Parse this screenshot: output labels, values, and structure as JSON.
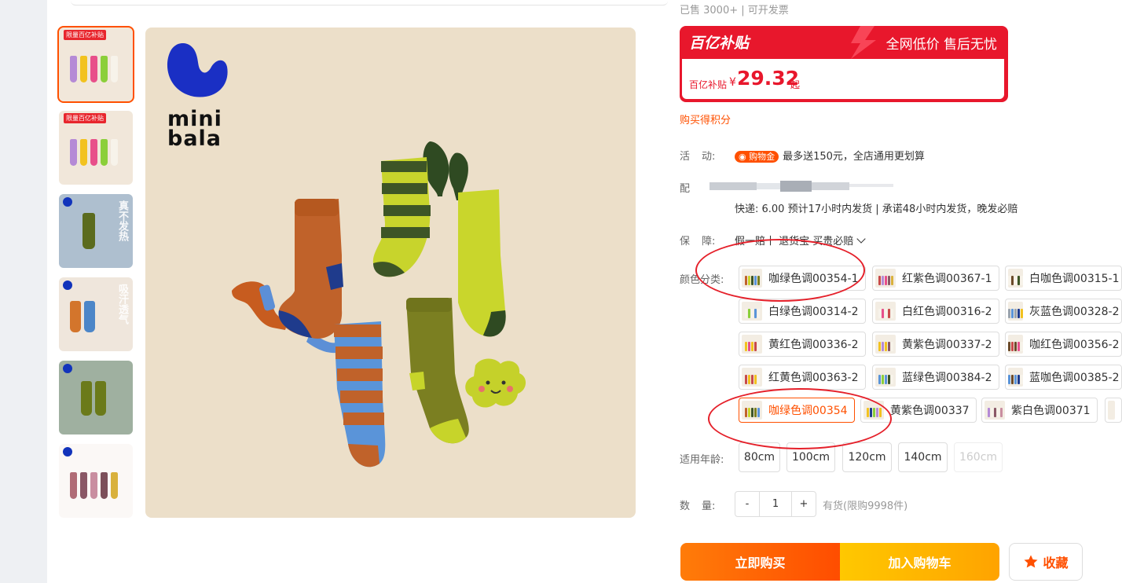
{
  "top": {
    "sold_text": "已售 3000+ | 可开发票"
  },
  "brand": {
    "logo_line1": "mini",
    "logo_line2": "bala"
  },
  "thumbnails": [
    {
      "badge": "限量百亿补贴",
      "overlay": ""
    },
    {
      "badge": "限量百亿补贴",
      "overlay": ""
    },
    {
      "badge": "",
      "overlay": "真不发热"
    },
    {
      "badge": "",
      "overlay": "吸汗透气"
    },
    {
      "badge": "",
      "overlay": ""
    },
    {
      "badge": "",
      "overlay": ""
    }
  ],
  "promo": {
    "badge": "百亿补贴",
    "slogan": "全网低价 售后无忧",
    "price_label": "百亿补贴",
    "currency": "¥",
    "price": "29.32",
    "price_suffix": "起"
  },
  "points_text": "购买得积分",
  "activity": {
    "label_a": "活",
    "label_b": "动:",
    "coin": "购物金",
    "text": "最多送150元，全店通用更划算"
  },
  "delivery": {
    "label": "配",
    "shipping": "快递: 6.00  预计17小时内发货 | 承诺48小时内发货，晚发必赔"
  },
  "guarantee": {
    "label_a": "保",
    "label_b": "障:",
    "text": "假一赔十 退货宝 买贵必赔"
  },
  "color": {
    "label": "颜色分类:",
    "options": [
      {
        "label": "咖绿色调00354-1",
        "selected": false
      },
      {
        "label": "红紫色调00367-1",
        "selected": false
      },
      {
        "label": "白咖色调00315-1",
        "selected": false
      },
      {
        "label": "白绿色调00314-2",
        "selected": false
      },
      {
        "label": "白红色调00316-2",
        "selected": false
      },
      {
        "label": "灰蓝色调00328-2",
        "selected": false
      },
      {
        "label": "黄红色调00336-2",
        "selected": false
      },
      {
        "label": "黄紫色调00337-2",
        "selected": false
      },
      {
        "label": "咖红色调00356-2",
        "selected": false
      },
      {
        "label": "红黄色调00363-2",
        "selected": false
      },
      {
        "label": "蓝绿色调00384-2",
        "selected": false
      },
      {
        "label": "蓝咖色调00385-2",
        "selected": false
      },
      {
        "label": "咖绿色调00354",
        "selected": true
      },
      {
        "label": "黄紫色调00337",
        "selected": false
      },
      {
        "label": "紫白色调00371",
        "selected": false
      }
    ]
  },
  "size": {
    "label": "适用年龄:",
    "options": [
      {
        "label": "80cm",
        "disabled": false
      },
      {
        "label": "100cm",
        "disabled": false
      },
      {
        "label": "120cm",
        "disabled": false
      },
      {
        "label": "140cm",
        "disabled": false
      },
      {
        "label": "160cm",
        "disabled": true
      }
    ]
  },
  "quantity": {
    "label_a": "数",
    "label_b": "量:",
    "minus": "-",
    "value": "1",
    "plus": "+",
    "stock": "有货(限购9998件)"
  },
  "actions": {
    "buy": "立即购买",
    "cart": "加入购物车",
    "favorite": "收藏"
  },
  "colors": {
    "accent": "#ff5000",
    "promo_red": "#e8172c",
    "annotation_red": "#e5202a"
  }
}
